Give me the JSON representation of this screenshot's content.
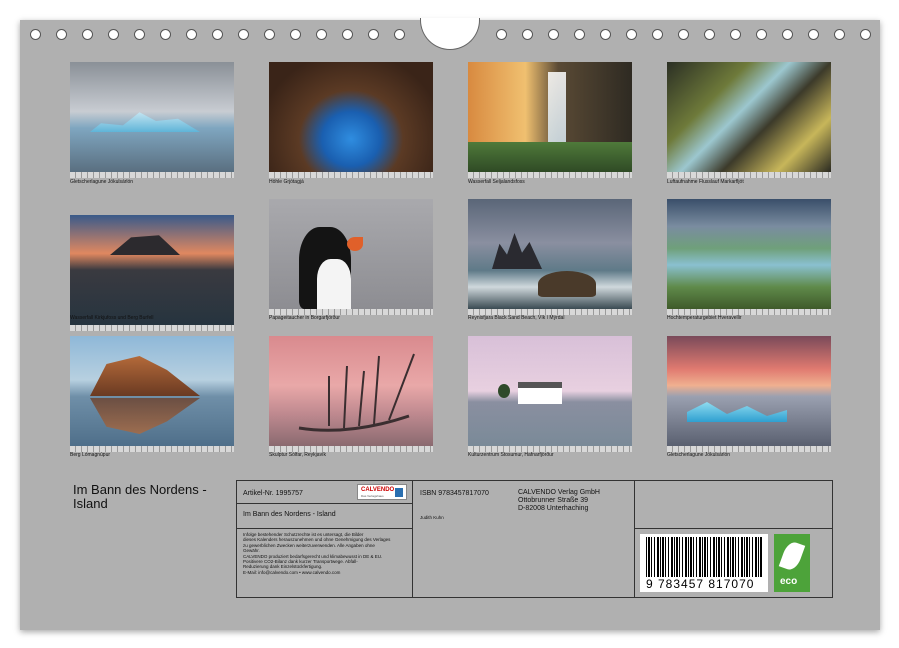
{
  "photos": [
    {
      "caption": "Gletscherlagune Jökulsárlón"
    },
    {
      "caption": "Höhle Grjótagjá"
    },
    {
      "caption": "Wasserfall Seljalandsfoss"
    },
    {
      "caption": "Luftaufnahme Flusslauf Markarfljót"
    },
    {
      "caption": "Wasserfall Kirkjufoss und Berg Burfell"
    },
    {
      "caption": "Papageitaucher in Borgarfjörður"
    },
    {
      "caption": "Reynisfjara Black Sand Beach, Vík í Mýrdal"
    },
    {
      "caption": "Hochtemperaturgebiet Hveravellir"
    },
    {
      "caption": "Berg Lómagnúpur"
    },
    {
      "caption": "Skulptur Sólfar, Reykjavík"
    },
    {
      "caption": "Kulturzentrum Stosumur, Hafnarfjörður"
    },
    {
      "caption": "Gletscherlagune Jökulsárlón"
    }
  ],
  "book": {
    "title": "Im Bann des Nordens - Island"
  },
  "info": {
    "article": "Artikel-Nr. 1995757",
    "logo_text": "CALVENDO",
    "logo_sub": "Das Verlagshaus",
    "title_line": "Im Bann des Nordens - Island",
    "legal": [
      "Infolge bestehender Schutzrechte ist es untersagt, die Bilder",
      "dieses Kalenders herauszunehmen und ohne Genehmigung des Verlages",
      "zu gewerblichen Zwecken weiterzuverwenden. Alle Angaben ohne",
      "Gewähr.",
      "CALVENDO produziert bedarfsgerecht und klimabewusst in DE & EU.",
      "Positivere CO2-Bilanz dank kurzer Transportwege. Abfall-",
      "Reduzierung dank Einzelstückfertigung.",
      "E-Mail: info@calvendo.com • www.calvendo.com"
    ],
    "isbn": "ISBN 9783457817070",
    "author": "Judith Kuhn",
    "publisher": [
      "CALVENDO Verlag GmbH",
      "Ottobrunner Straße 39",
      "D-82008 Unterhaching"
    ],
    "barcode_number": "9 783457 817070",
    "eco_label": "eco"
  }
}
